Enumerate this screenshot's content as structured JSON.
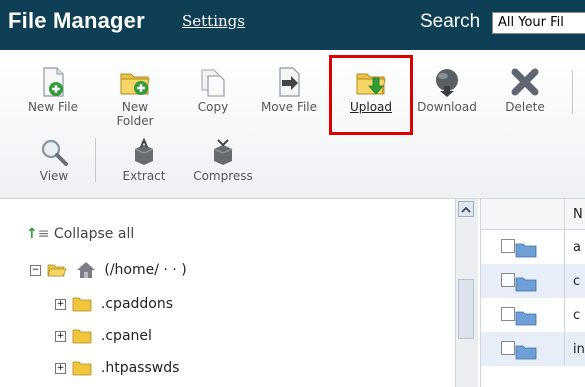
{
  "header": {
    "title": "File Manager",
    "settings_label": "Settings",
    "search_label": "Search",
    "search_scope": "All Your Fil"
  },
  "toolbar": {
    "new_file": "New File",
    "new_folder_line1": "New",
    "new_folder_line2": "Folder",
    "copy": "Copy",
    "move_file": "Move File",
    "upload": "Upload",
    "download": "Download",
    "delete": "Delete",
    "view": "View",
    "extract": "Extract",
    "compress": "Compress"
  },
  "tree": {
    "collapse_all": "Collapse all",
    "root_label": "(/home/  ·  ·  )",
    "items": [
      {
        "label": ".cpaddons"
      },
      {
        "label": ".cpanel"
      },
      {
        "label": ".htpasswds"
      }
    ]
  },
  "filelist": {
    "header_name": "N",
    "rows": [
      {
        "name": "a"
      },
      {
        "name": "c"
      },
      {
        "name": "c"
      },
      {
        "name": "in"
      }
    ]
  },
  "colors": {
    "header_bg": "#0f3f54",
    "highlight": "#dd0000",
    "row_alt": "#e7eef8"
  },
  "icons": {
    "new_file": "new-file-icon",
    "new_folder": "new-folder-icon",
    "copy": "copy-icon",
    "move_file": "move-file-icon",
    "upload": "upload-icon",
    "download": "download-icon",
    "delete": "delete-icon",
    "view": "magnifier-icon",
    "extract": "extract-icon",
    "compress": "compress-icon"
  }
}
